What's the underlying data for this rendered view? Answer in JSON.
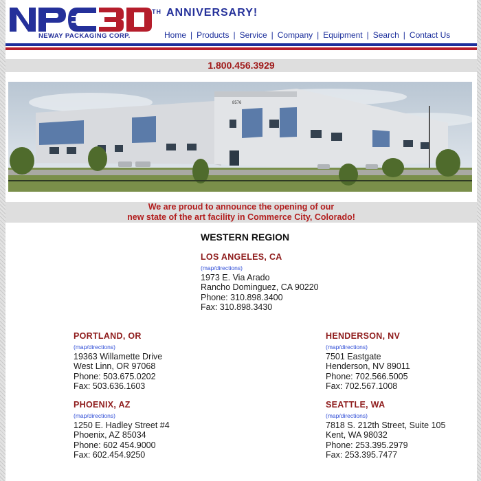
{
  "header": {
    "logo_text": "NPC30",
    "logo_subtitle": "NEWAY PACKAGING CORP.",
    "anniversary_sup": "TH",
    "anniversary": "ANNIVERSARY!"
  },
  "nav": [
    "Home",
    "Products",
    "Service",
    "Company",
    "Equipment",
    "Search",
    "Contact Us"
  ],
  "phone": "1.800.456.3929",
  "announcement": {
    "line1": "We are proud to announce the opening of our",
    "line2": "new state of the art facility in Commerce City, Colorado!"
  },
  "region_title": "WESTERN REGION",
  "locations": {
    "la": {
      "city": "LOS ANGELES, CA",
      "map": "(map/directions)",
      "street": "1973 E. Via Arado",
      "citystate": "Rancho Dominguez, CA 90220",
      "phone": "Phone: 310.898.3400",
      "fax": "Fax: 310.898.3430"
    },
    "portland": {
      "city": "PORTLAND, OR",
      "map": "(map/directions)",
      "street": "19363 Willamette Drive",
      "citystate": "West Linn, OR 97068",
      "phone": "Phone: 503.675.0202",
      "fax": "Fax: 503.636.1603"
    },
    "henderson": {
      "city": "HENDERSON, NV",
      "map": "(map/directions)",
      "street": "7501 Eastgate",
      "citystate": "Henderson, NV 89011",
      "phone": "Phone: 702.566.5005",
      "fax": "Fax: 702.567.1008"
    },
    "phoenix": {
      "city": "PHOENIX, AZ",
      "map": "(map/directions)",
      "street": "1250 E. Hadley Street #4",
      "citystate": "Phoenix, AZ 85034",
      "phone": "Phone: 602 454.9000",
      "fax": "Fax: 602.454.9250"
    },
    "seattle": {
      "city": "SEATTLE, WA",
      "map": "(map/directions)",
      "street": "7818 S. 212th Street, Suite 105",
      "citystate": "Kent, WA 98032",
      "phone": "Phone: 253.395.2979",
      "fax": "Fax: 253.395.7477"
    }
  },
  "photo": {
    "building_number": "8576"
  },
  "colors": {
    "brand_blue": "#1c2f9c",
    "brand_red": "#b51d2b",
    "city_red": "#8e1a1a",
    "link_blue": "#2d4bd6"
  }
}
